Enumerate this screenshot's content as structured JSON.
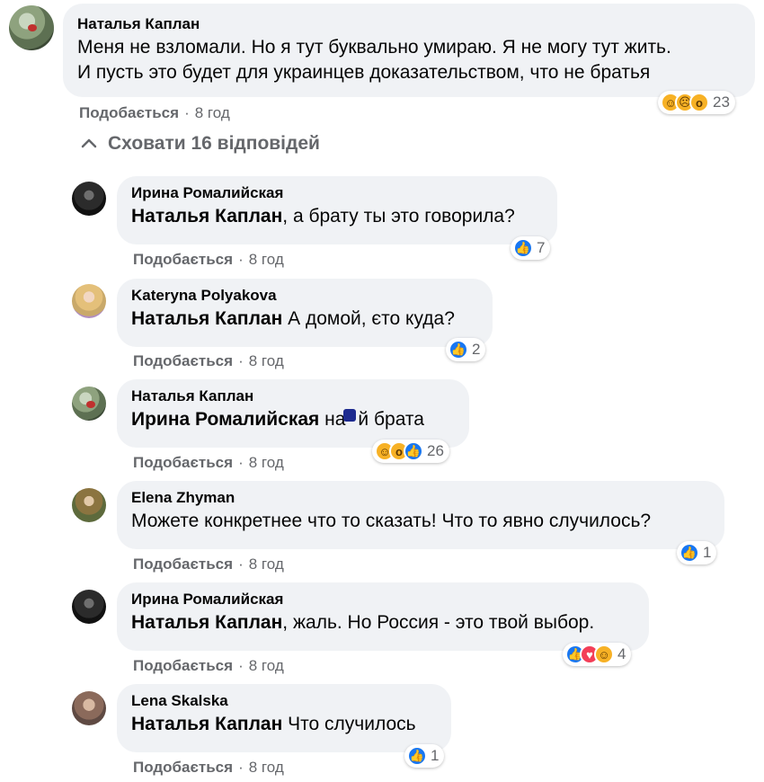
{
  "main": {
    "text_line1": "Меня не взломали. Но я тут буквально умираю. Я не могу тут жить.",
    "text_line2": "И пусть это будет для украинцев доказательством, что не братья",
    "author": "Наталья Каплан",
    "like_label": "Подобається",
    "time": "8 год",
    "reactions": [
      "haha-icon",
      "sad-icon",
      "wow-icon"
    ],
    "reaction_count": "23"
  },
  "replies_toggle": {
    "label": "Сховати 16 відповідей",
    "icon": "chevron-up-icon"
  },
  "replies": [
    {
      "author": "Ирина Ромалийская",
      "mention": "Наталья Каплан",
      "text": ", а брату ты это говорила?",
      "like_label": "Подобається",
      "time": "8 год",
      "reactions": [
        "like-icon"
      ],
      "reaction_count": "7"
    },
    {
      "author": "Kateryna Polyakova",
      "mention": "Наталья Каплан",
      "text": " А домой, єто куда?",
      "like_label": "Подобається",
      "time": "8 год",
      "reactions": [
        "like-icon"
      ],
      "reaction_count": "2"
    },
    {
      "author": "Наталья Каплан",
      "mention": "Ирина Ромалийская",
      "text_a": " на",
      "text_b": "й брата",
      "like_label": "Подобається",
      "time": "8 год",
      "reactions": [
        "haha-icon",
        "wow-icon",
        "like-icon"
      ],
      "reaction_count": "26"
    },
    {
      "author": "Elena Zhyman",
      "text": "Можете конкретнее что то сказать! Что то явно случилось?",
      "like_label": "Подобається",
      "time": "8 год",
      "reactions": [
        "like-icon"
      ],
      "reaction_count": "1"
    },
    {
      "author": "Ирина Ромалийская",
      "mention": "Наталья Каплан",
      "text": ", жаль. Но Россия - это твой выбор.",
      "like_label": "Подобається",
      "time": "8 год",
      "reactions": [
        "like-icon",
        "love-icon",
        "haha-icon"
      ],
      "reaction_count": "4"
    },
    {
      "author": "Lena Skalska",
      "mention": "Наталья Каплан",
      "text": " Что случилось",
      "like_label": "Подобається",
      "time": "8 год",
      "reactions": [
        "like-icon"
      ],
      "reaction_count": "1"
    }
  ],
  "colors": {
    "bubble": "#f0f2f5",
    "meta": "#65676b",
    "like_blue": "#1877f2",
    "love_red": "#f33e58",
    "emoji_yellow": "#f7b125"
  }
}
